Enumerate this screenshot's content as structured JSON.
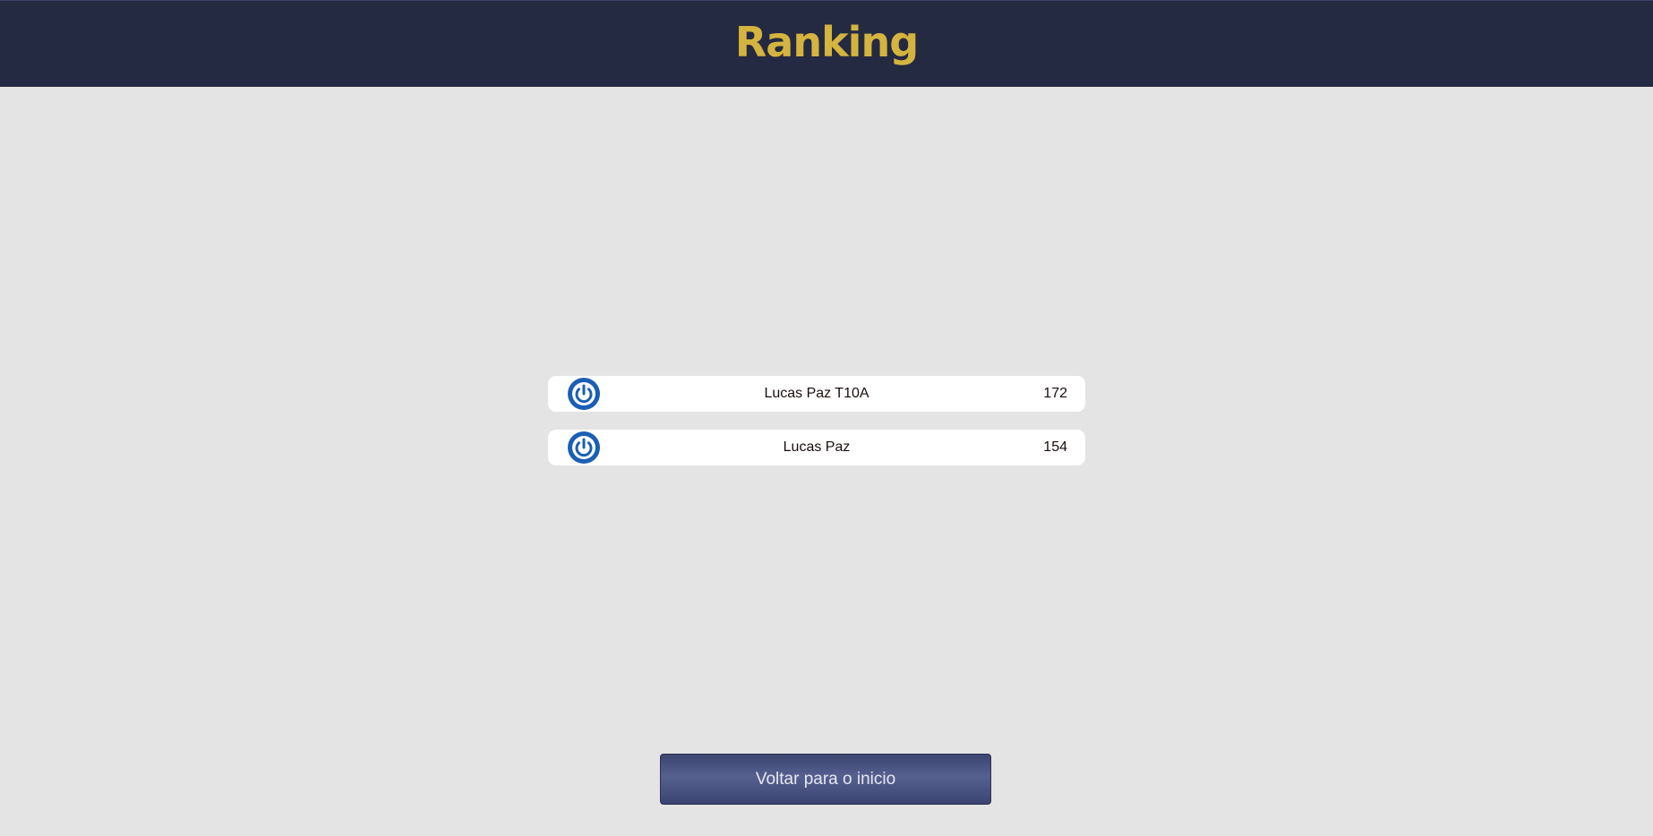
{
  "header": {
    "title": "Ranking"
  },
  "ranking": {
    "entries": [
      {
        "name": "Lucas Paz T10A",
        "score": "172",
        "icon": "power-icon"
      },
      {
        "name": "Lucas Paz",
        "score": "154",
        "icon": "power-icon"
      }
    ]
  },
  "actions": {
    "back_label": "Voltar para o inicio"
  },
  "colors": {
    "header_bg": "#242a42",
    "title": "#d4b43e",
    "page_bg": "#e4e4e4",
    "icon_blue": "#1a5fb4",
    "button_bg": "#4a5384"
  }
}
